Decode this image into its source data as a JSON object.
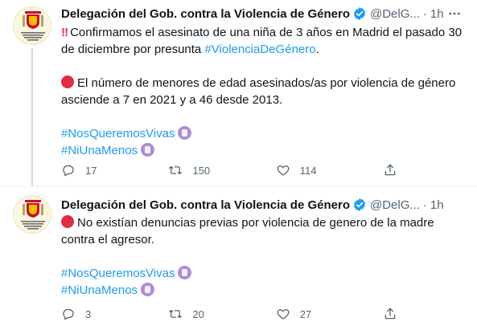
{
  "tweets": [
    {
      "name": "Delegación del Gob. contra la Violencia de Género",
      "handle": "@DelG...",
      "dot": "·",
      "time": "1h",
      "avatar_text": "DELEGACIÓN DEL GOBIERNO CONTRA LA VIOLENCIA DE GÉNERO",
      "line1_text": "Confirmamos el asesinato de una niña de 3 años en Madrid el pasado 30 de diciembre por presunta ",
      "line1_tag": "#ViolenciaDeGénero",
      "line1_end": ".",
      "line2_text": "El número de menores de edad asesinados/as por violencia de género asciende a 7 en 2021 y a 46 desde 2013.",
      "hashtag1": "#NosQueremosVivas",
      "hashtag2": "#NiUnaMenos",
      "replies": "17",
      "retweets": "150",
      "likes": "114"
    },
    {
      "name": "Delegación del Gob. contra la Violencia de Género",
      "handle": "@DelG...",
      "dot": "·",
      "time": "1h",
      "avatar_text": "DELEGACIÓN DEL GOBIERNO CONTRA LA VIOLENCIA DE GÉNERO",
      "line1_text": "No existían denuncias previas por violencia de genero de la madre contra el agresor.",
      "hashtag1": "#NosQueremosVivas",
      "hashtag2": "#NiUnaMenos",
      "replies": "3",
      "retweets": "20",
      "likes": "27"
    }
  ],
  "icons": {
    "more": "more-icon",
    "reply": "reply-icon",
    "retweet": "retweet-icon",
    "like": "heart-icon",
    "share": "share-icon",
    "verified": "verified-badge-icon"
  },
  "colors": {
    "link": "#1d9bf0",
    "muted": "#536471",
    "text": "#0f1419",
    "verified": "#1d9bf0",
    "red": "#dd2e44",
    "thread_line": "#cfd9de"
  }
}
